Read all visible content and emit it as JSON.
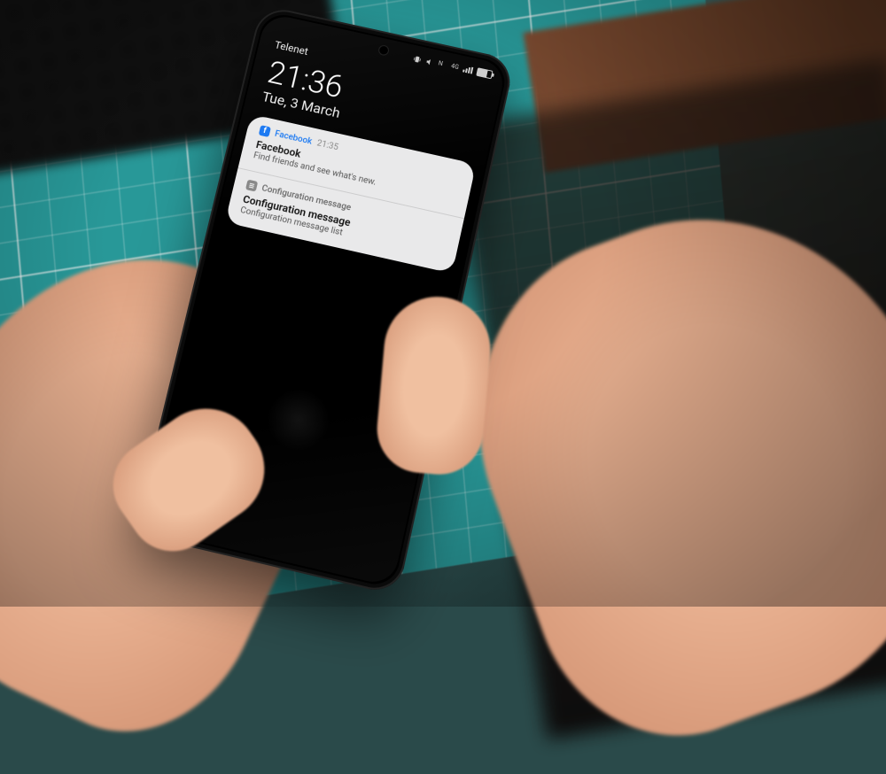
{
  "status": {
    "network_type": "4G",
    "battery_percent": 70
  },
  "carrier": "Telenet",
  "clock": {
    "time": "21:36",
    "date": "Tue, 3 March"
  },
  "notifications": [
    {
      "app_icon": "facebook-icon",
      "app_color": "#1877f2",
      "app_name": "Facebook",
      "time": "21:35",
      "title": "Facebook",
      "body": "Find friends and see what's new."
    },
    {
      "app_icon": "settings-icon",
      "app_color": "#888888",
      "app_name": "Configuration message",
      "time": "",
      "title": "Configuration message",
      "body": "Configuration message list"
    }
  ],
  "shortcut": {
    "name": "phone-dialer"
  }
}
